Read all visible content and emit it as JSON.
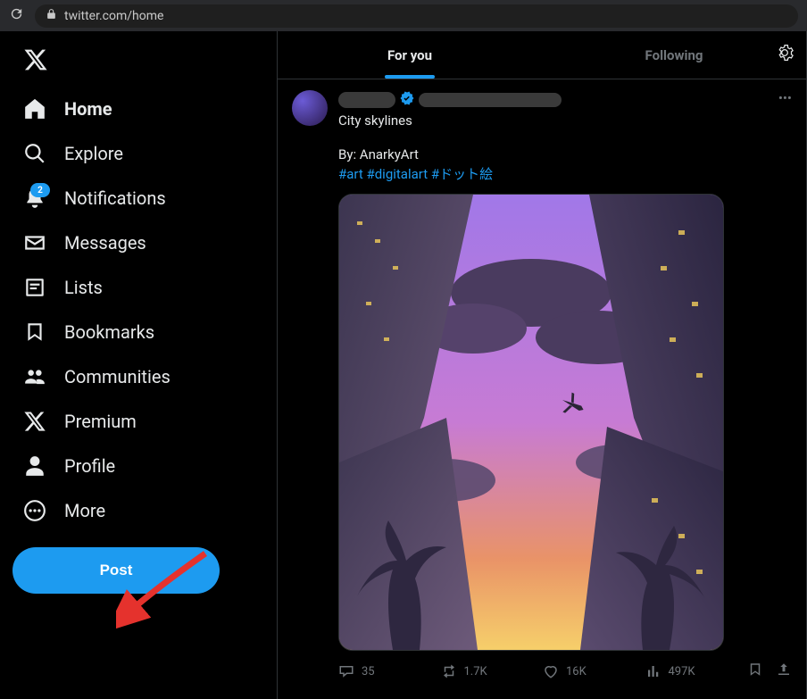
{
  "browser": {
    "url": "twitter.com/home"
  },
  "sidebar": {
    "items": [
      {
        "label": "Home",
        "active": true
      },
      {
        "label": "Explore"
      },
      {
        "label": "Notifications",
        "badge": "2"
      },
      {
        "label": "Messages"
      },
      {
        "label": "Lists"
      },
      {
        "label": "Bookmarks"
      },
      {
        "label": "Communities"
      },
      {
        "label": "Premium"
      },
      {
        "label": "Profile"
      },
      {
        "label": "More"
      }
    ],
    "post_label": "Post"
  },
  "tabs": {
    "for_you": "For you",
    "following": "Following"
  },
  "tweet": {
    "text": "City skylines",
    "byline": "By: AnarkyArt",
    "hashtags": "#art #digitalart #ドット絵",
    "replies": "35",
    "retweets": "1.7K",
    "likes": "16K",
    "views": "497K"
  }
}
